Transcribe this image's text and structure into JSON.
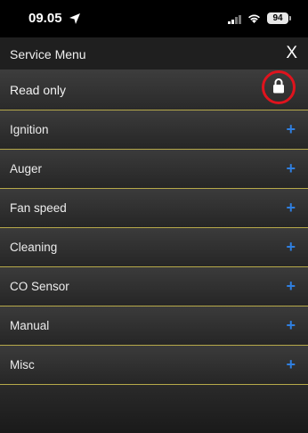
{
  "status_bar": {
    "time": "09.05",
    "battery": "94",
    "icons": [
      "location-arrow-icon",
      "signal-icon",
      "wifi-icon",
      "battery-icon"
    ]
  },
  "header": {
    "title": "Service Menu",
    "close_label": "X"
  },
  "readonly": {
    "label": "Read only",
    "icon": "lock-icon",
    "highlight_color": "#e0131d"
  },
  "menu": {
    "items": [
      {
        "label": "Ignition",
        "icon": "plus-icon"
      },
      {
        "label": "Auger",
        "icon": "plus-icon"
      },
      {
        "label": "Fan speed",
        "icon": "plus-icon"
      },
      {
        "label": "Cleaning",
        "icon": "plus-icon"
      },
      {
        "label": "CO Sensor",
        "icon": "plus-icon"
      },
      {
        "label": "Manual",
        "icon": "plus-icon"
      },
      {
        "label": "Misc",
        "icon": "plus-icon"
      }
    ],
    "expand_symbol": "+"
  },
  "colors": {
    "divider": "#b6a94a",
    "accent": "#2f7fe0"
  }
}
